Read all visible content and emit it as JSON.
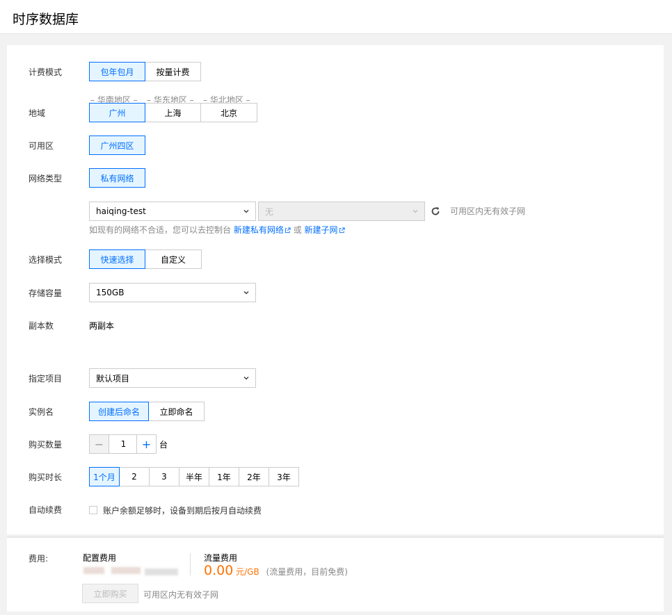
{
  "header": {
    "title": "时序数据库"
  },
  "form": {
    "billing": {
      "label": "计费模式",
      "options": [
        "包年包月",
        "按量计费"
      ],
      "selected": 0
    },
    "region": {
      "label": "地域",
      "groups": [
        "华南地区",
        "华东地区",
        "华北地区"
      ],
      "options": [
        "广州",
        "上海",
        "北京"
      ],
      "selected": 0
    },
    "zone": {
      "label": "可用区",
      "value": "广州四区"
    },
    "network": {
      "label": "网络类型",
      "value": "私有网络",
      "vpc_value": "haiqing-test",
      "subnet_value": "无",
      "subnet_hint": "可用区内无有效子网",
      "help_prefix": "如现有的网络不合适，您可以去控制台",
      "create_vpc": "新建私有网络",
      "or": "或",
      "create_subnet": "新建子网"
    },
    "mode": {
      "label": "选择模式",
      "options": [
        "快速选择",
        "自定义"
      ],
      "selected": 0
    },
    "storage": {
      "label": "存储容量",
      "value": "150GB"
    },
    "replica": {
      "label": "副本数",
      "value": "两副本"
    },
    "project": {
      "label": "指定项目",
      "value": "默认项目"
    },
    "instance_name": {
      "label": "实例名",
      "options": [
        "创建后命名",
        "立即命名"
      ],
      "selected": 0
    },
    "quantity": {
      "label": "购买数量",
      "value": "1",
      "unit": "台",
      "minus": "−",
      "plus": "+"
    },
    "duration": {
      "label": "购买时长",
      "options": [
        "1个月",
        "2",
        "3",
        "半年",
        "1年",
        "2年",
        "3年"
      ],
      "selected": 0
    },
    "auto_renew": {
      "label": "自动续费",
      "text": "账户余额足够时，设备到期后按月自动续费",
      "checked": false
    }
  },
  "footer": {
    "label": "费用:",
    "config_fee_label": "配置费用",
    "traffic_fee_label": "流量费用",
    "traffic_price": "0.00",
    "traffic_unit": "元/GB",
    "traffic_note": "(流量费用，目前免费)",
    "buy_button": "立即购买",
    "buy_hint": "可用区内无有效子网"
  },
  "colors": {
    "accent": "#006eff",
    "selected_bg": "#e5f5ff",
    "price": "#ff7200"
  }
}
